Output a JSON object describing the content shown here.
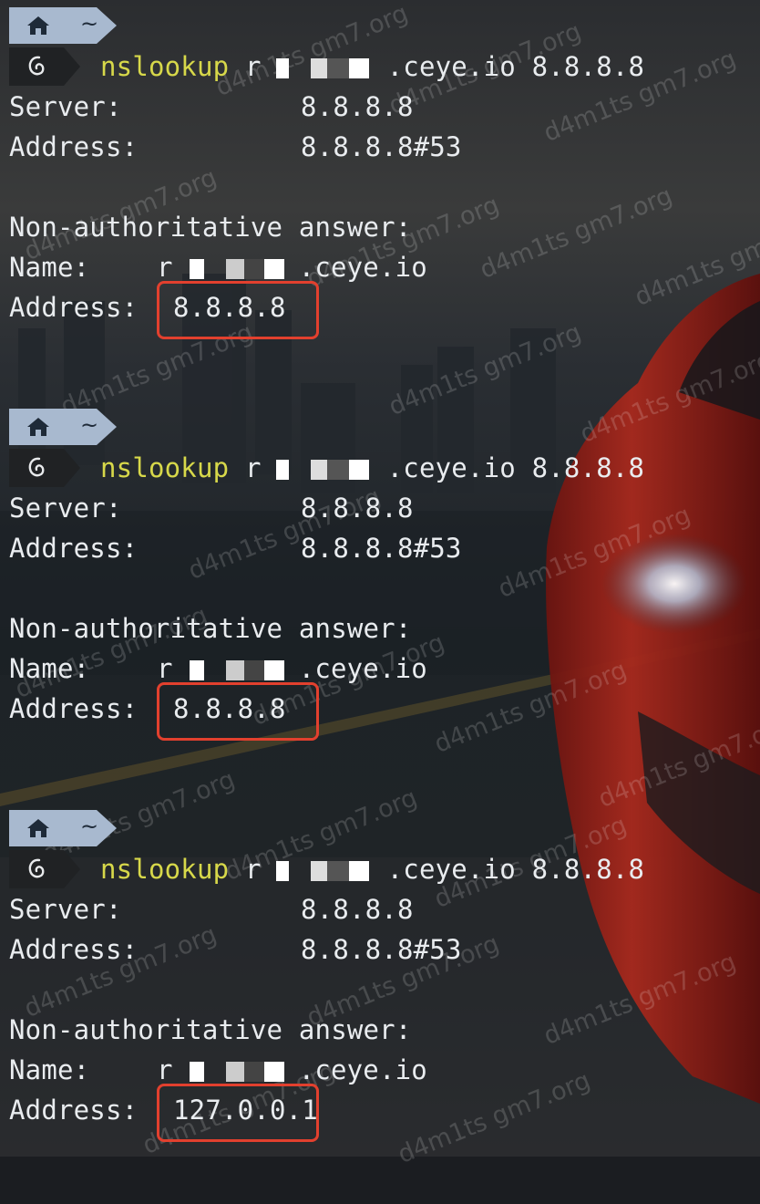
{
  "prompt": {
    "cwd": "~"
  },
  "blocks": [
    {
      "command": {
        "name": "nslookup",
        "target_prefix": "r",
        "target_suffix": ".ceye.io",
        "dns": "8.8.8.8"
      },
      "server": {
        "label": "Server:",
        "value": "8.8.8.8"
      },
      "server_address": {
        "label": "Address:",
        "value": "8.8.8.8#53"
      },
      "answer_header": "Non-authoritative answer:",
      "name_line": {
        "label": "Name:",
        "prefix": "r",
        "suffix": ".ceye.io"
      },
      "answer_address": {
        "label": "Address:",
        "value": "8.8.8.8"
      }
    },
    {
      "command": {
        "name": "nslookup",
        "target_prefix": "r",
        "target_suffix": ".ceye.io",
        "dns": "8.8.8.8"
      },
      "server": {
        "label": "Server:",
        "value": "8.8.8.8"
      },
      "server_address": {
        "label": "Address:",
        "value": "8.8.8.8#53"
      },
      "answer_header": "Non-authoritative answer:",
      "name_line": {
        "label": "Name:",
        "prefix": "r",
        "suffix": ".ceye.io"
      },
      "answer_address": {
        "label": "Address:",
        "value": "8.8.8.8"
      }
    },
    {
      "command": {
        "name": "nslookup",
        "target_prefix": "r",
        "target_suffix": ".ceye.io",
        "dns": "8.8.8.8"
      },
      "server": {
        "label": "Server:",
        "value": "8.8.8.8"
      },
      "server_address": {
        "label": "Address:",
        "value": "8.8.8.8#53"
      },
      "answer_header": "Non-authoritative answer:",
      "name_line": {
        "label": "Name:",
        "prefix": "r",
        "suffix": ".ceye.io"
      },
      "answer_address": {
        "label": "Address:",
        "value": "127.0.0.1"
      }
    }
  ],
  "watermark": "d4m1ts gm7.org",
  "colors": {
    "command": "#d7d84a",
    "text": "#e9ecef",
    "highlight_box": "#e2402e",
    "powerline_home": "#a8b9cf",
    "powerline_os": "#202224"
  },
  "icons": {
    "home": "home-icon",
    "os": "debian-swirl-icon"
  }
}
